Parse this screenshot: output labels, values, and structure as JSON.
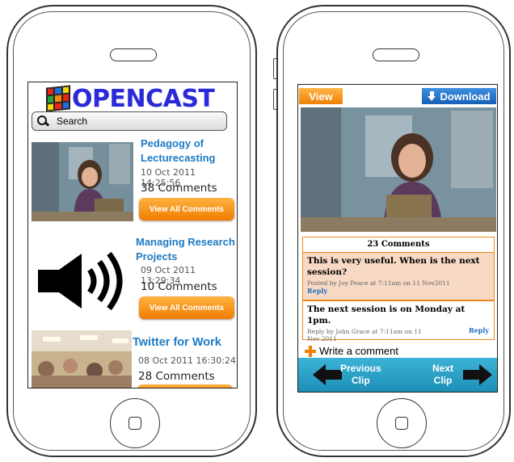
{
  "left": {
    "logo_text": "OPENCAST",
    "search_label": "Search",
    "items": [
      {
        "title_line1": "Pedagogy of",
        "title_line2": "Lecturecasting",
        "date": "10 Oct 2011 14:25:56",
        "comments": "38 Comments",
        "button": "View All Comments"
      },
      {
        "title_line1": "Managing Research",
        "title_line2": "Projects",
        "date": "09 Oct 2011 13:29:34",
        "comments": "10 Comments",
        "button": "View All Comments"
      },
      {
        "title_line1": "Twitter for Work",
        "date": "08 Oct 2011 16:30:24",
        "comments": "28 Comments"
      }
    ]
  },
  "right": {
    "view_label": "View",
    "download_label": "Download",
    "comments_header": "23 Comments",
    "comment1": {
      "text": "This is very useful. When is the next session?",
      "meta": "Posted by Joy  Peace at 7:11am on 11 Nov2011",
      "reply": "Reply"
    },
    "comment2": {
      "text": "The next session is on Monday at 1pm.",
      "meta": "Reply by John  Grace at 7:11am on 11 Nov 2011",
      "reply": "Reply"
    },
    "write_label": "Write a comment",
    "prev_line1": "Previous",
    "prev_line2": "Clip",
    "next_line1": "Next",
    "next_line2": "Clip"
  },
  "colors": {
    "link_blue": "#1e7bc4",
    "orange": "#f07f05",
    "nav_teal": "#2aa3c9",
    "logo_blue": "#2a2ad8"
  }
}
